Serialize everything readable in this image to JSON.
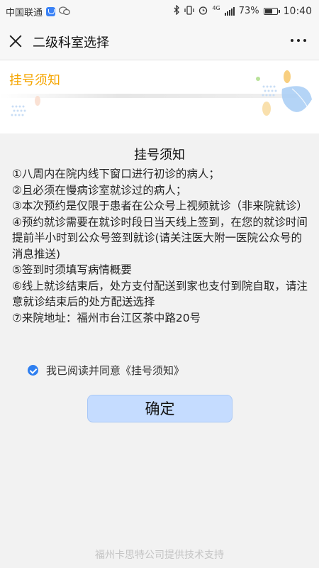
{
  "status_bar": {
    "carrier": "中国联通",
    "network": "4G",
    "battery_percent": "73%",
    "battery_level": 0.73,
    "time": "10:40",
    "icons": [
      "carrier-shield-icon",
      "wechat-icon",
      "bluetooth-icon",
      "vibrate-icon",
      "alarm-icon",
      "signal-icon",
      "battery-icon"
    ]
  },
  "nav": {
    "title": "二级科室选择",
    "close_icon": "close-icon",
    "more_icon": "more-icon"
  },
  "banner": {
    "title": "挂号须知",
    "colors": {
      "title": "#f5a500",
      "accent_orange": "#f7c76a",
      "accent_blue": "#a7cdf5"
    }
  },
  "notice": {
    "title": "挂号须知",
    "items": [
      "①八周内在院内线下窗口进行初诊的病人；",
      "②且必须在慢病诊室就诊过的病人；",
      "③本次预约是仅限于患者在公众号上视频就诊（非来院就诊）",
      "④预约就诊需要在就诊时段日当天线上签到，在您的就诊时间提前半小时到公众号签到就诊(请关注医大附一医院公众号的消息推送)",
      "⑤签到时须填写病情概要",
      "⑥线上就诊结束后，处方支付配送到家也支付到院自取，请注意就诊结束后的处方配送选择",
      "⑦来院地址：福州市台江区茶中路20号"
    ]
  },
  "agreement": {
    "checked": true,
    "label": "我已阅读并同意《挂号须知》"
  },
  "confirm_button": {
    "label": "确定",
    "color": "#c5dcff"
  },
  "footer": {
    "text": "福州卡思特公司提供技术支持"
  }
}
